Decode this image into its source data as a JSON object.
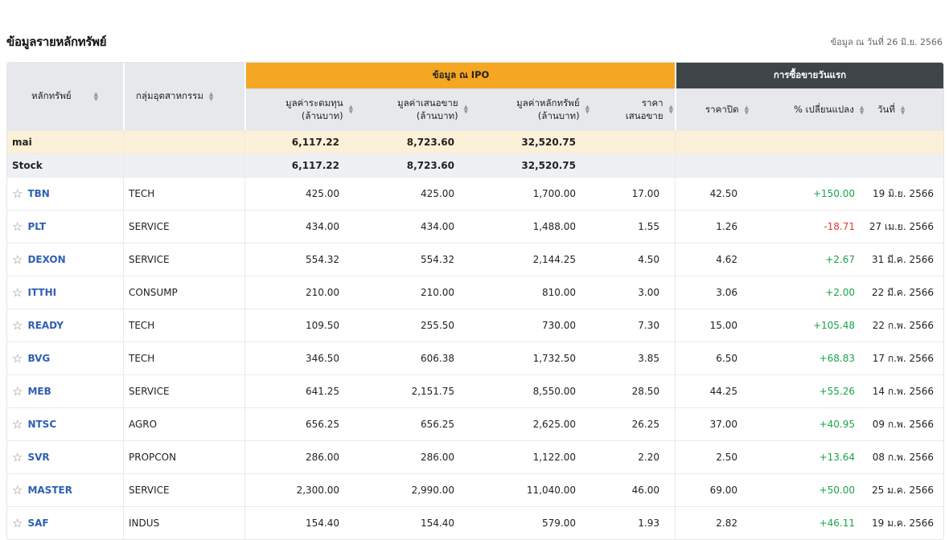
{
  "header": {
    "title": "ข้อมูลรายหลักทรัพย์",
    "as_of": "ข้อมูล ณ วันที่ 26 มิ.ย. 2566"
  },
  "table": {
    "group_ipo": "ข้อมูล ณ IPO",
    "group_first_day": "การซื้อขายวันแรก",
    "columns": {
      "symbol": "หลักทรัพย์",
      "industry": "กลุ่มอุตสาหกรรม",
      "market_cap_l1": "มูลค่าระดมทุน",
      "market_cap_l2": "(ล้านบาท)",
      "offer_value_l1": "มูลค่าเสนอขาย",
      "offer_value_l2": "(ล้านบาท)",
      "security_value_l1": "มูลค่าหลักทรัพย์",
      "security_value_l2": "(ล้านบาท)",
      "offer_price_l1": "ราคา",
      "offer_price_l2": "เสนอขาย",
      "close": "ราคาปิด",
      "change": "% เปลี่ยนแปลง",
      "date": "วันที่"
    },
    "summary": [
      {
        "label": "mai",
        "a": "6,117.22",
        "b": "8,723.60",
        "c": "32,520.75"
      },
      {
        "label": "Stock",
        "a": "6,117.22",
        "b": "8,723.60",
        "c": "32,520.75"
      }
    ],
    "rows": [
      {
        "symbol": "TBN",
        "industry": "TECH",
        "a": "425.00",
        "b": "425.00",
        "c": "1,700.00",
        "price": "17.00",
        "close": "42.50",
        "chg": "+150.00",
        "dir": "pos",
        "date": "19 มิ.ย. 2566"
      },
      {
        "symbol": "PLT",
        "industry": "SERVICE",
        "a": "434.00",
        "b": "434.00",
        "c": "1,488.00",
        "price": "1.55",
        "close": "1.26",
        "chg": "-18.71",
        "dir": "neg",
        "date": "27 เม.ย. 2566"
      },
      {
        "symbol": "DEXON",
        "industry": "SERVICE",
        "a": "554.32",
        "b": "554.32",
        "c": "2,144.25",
        "price": "4.50",
        "close": "4.62",
        "chg": "+2.67",
        "dir": "pos",
        "date": "31 มี.ค. 2566"
      },
      {
        "symbol": "ITTHI",
        "industry": "CONSUMP",
        "a": "210.00",
        "b": "210.00",
        "c": "810.00",
        "price": "3.00",
        "close": "3.06",
        "chg": "+2.00",
        "dir": "pos",
        "date": "22 มี.ค. 2566"
      },
      {
        "symbol": "READY",
        "industry": "TECH",
        "a": "109.50",
        "b": "255.50",
        "c": "730.00",
        "price": "7.30",
        "close": "15.00",
        "chg": "+105.48",
        "dir": "pos",
        "date": "22 ก.พ. 2566"
      },
      {
        "symbol": "BVG",
        "industry": "TECH",
        "a": "346.50",
        "b": "606.38",
        "c": "1,732.50",
        "price": "3.85",
        "close": "6.50",
        "chg": "+68.83",
        "dir": "pos",
        "date": "17 ก.พ. 2566"
      },
      {
        "symbol": "MEB",
        "industry": "SERVICE",
        "a": "641.25",
        "b": "2,151.75",
        "c": "8,550.00",
        "price": "28.50",
        "close": "44.25",
        "chg": "+55.26",
        "dir": "pos",
        "date": "14 ก.พ. 2566"
      },
      {
        "symbol": "NTSC",
        "industry": "AGRO",
        "a": "656.25",
        "b": "656.25",
        "c": "2,625.00",
        "price": "26.25",
        "close": "37.00",
        "chg": "+40.95",
        "dir": "pos",
        "date": "09 ก.พ. 2566"
      },
      {
        "symbol": "SVR",
        "industry": "PROPCON",
        "a": "286.00",
        "b": "286.00",
        "c": "1,122.00",
        "price": "2.20",
        "close": "2.50",
        "chg": "+13.64",
        "dir": "pos",
        "date": "08 ก.พ. 2566"
      },
      {
        "symbol": "MASTER",
        "industry": "SERVICE",
        "a": "2,300.00",
        "b": "2,990.00",
        "c": "11,040.00",
        "price": "46.00",
        "close": "69.00",
        "chg": "+50.00",
        "dir": "pos",
        "date": "25 ม.ค. 2566"
      },
      {
        "symbol": "SAF",
        "industry": "INDUS",
        "a": "154.40",
        "b": "154.40",
        "c": "579.00",
        "price": "1.93",
        "close": "2.82",
        "chg": "+46.11",
        "dir": "pos",
        "date": "19 ม.ค. 2566"
      }
    ]
  },
  "colors": {
    "header_bg": "#e6e8ec",
    "ipo_band": "#f5a623",
    "first_day_band": "#3f4448",
    "positive": "#1aa34a",
    "negative": "#e03a3a",
    "symbol_link": "#2f5fb3",
    "mai_row": "#fdf0d8"
  },
  "icons": {
    "favorite": "star-outline-icon",
    "sort": "sort-arrows-icon"
  }
}
